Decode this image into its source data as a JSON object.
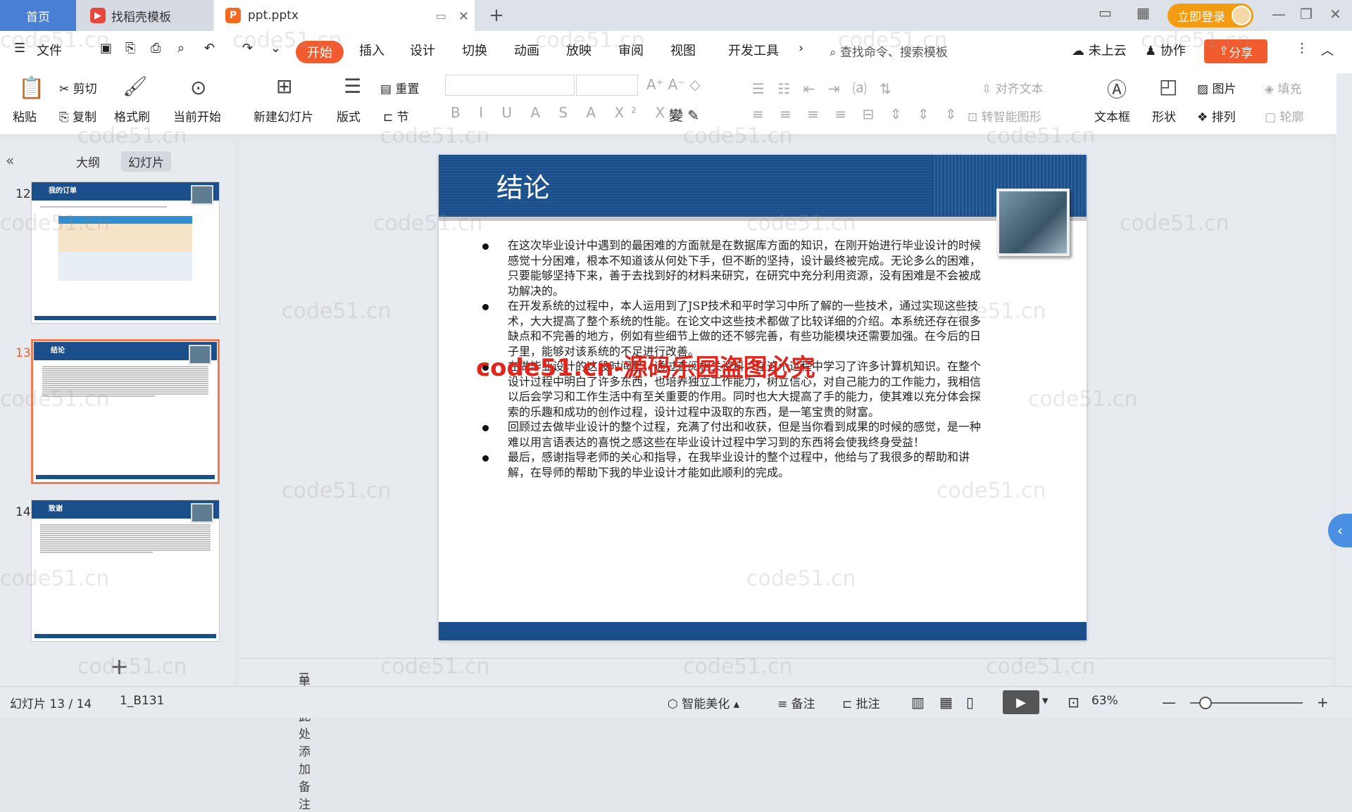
{
  "tabs": {
    "home": "首页",
    "template": "找稻壳模板",
    "document": "ppt.pptx"
  },
  "account": {
    "login": "立即登录"
  },
  "menu": {
    "file": "文件",
    "start": "开始",
    "insert": "插入",
    "design": "设计",
    "transition": "切换",
    "animation": "动画",
    "slideshow": "放映",
    "review": "审阅",
    "view": "视图",
    "devtools": "开发工具",
    "search": "查找命令、搜索模板",
    "cloud": "未上云",
    "collab": "协作",
    "share": "分享"
  },
  "ribbon": {
    "paste": "粘贴",
    "cut": "剪切",
    "copy": "复制",
    "format_painter": "格式刷",
    "from_current": "当前开始",
    "new_slide": "新建幻灯片",
    "layout": "版式",
    "reset": "重置",
    "section": "节",
    "align_text": "对齐文本",
    "smart_graphic": "转智能图形",
    "textbox": "文本框",
    "shape": "形状",
    "picture": "图片",
    "fill": "填充",
    "arrange": "排列",
    "outline": "轮廓"
  },
  "sidepanel": {
    "tab_outline": "大纲",
    "tab_slides": "幻灯片",
    "thumbs": [
      {
        "num": "12",
        "title": "我的订单"
      },
      {
        "num": "13",
        "title": "结论"
      },
      {
        "num": "14",
        "title": "致谢"
      }
    ]
  },
  "slide": {
    "title": "结论",
    "bullets": [
      "在这次毕业设计中遇到的最困难的方面就是在数据库方面的知识，在刚开始进行毕业设计的时候感觉十分困难，根本不知道该从何处下手，但不断的坚持，设计最终被完成。无论多么的困难，只要能够坚持下来，善于去找到好的材料来研究，在研究中充分利用资源，没有困难是不会被成功解决的。",
      "在开发系统的过程中，本人运用到了JSP技术和平时学习中所了解的一些技术，通过实现这些技术，大大提高了整个系统的性能。在论文中这些技术都做了比较详细的介绍。本系统还存在很多缺点和不完善的地方，例如有些细节上做的还不够完善，有些功能模块还需要加强。在今后的日子里，能够对该系统的不足进行改善。",
      "在做毕业设计的这段时间里，通过查阅相关资料，在这个过程中学习了许多计算机知识。在整个设计过程中明白了许多东西，也培养独立工作能力，树立信心，对自己能力的工作能力，我相信以后会学习和工作生活中有至关重要的作用。同时也大大提高了手的能力，使其难以充分体会探索的乐趣和成功的创作过程，设计过程中汲取的东西，是一笔宝贵的财富。",
      "回顾过去做毕业设计的整个过程，充满了付出和收获，但是当你看到成果的时候的感觉，是一种难以用言语表达的喜悦之感这些在毕业设计过程中学习到的东西将会使我终身受益！",
      "最后，感谢指导老师的关心和指导，在我毕业设计的整个过程中，他给与了我很多的帮助和讲解，在导师的帮助下我的毕业设计才能如此顺利的完成。"
    ]
  },
  "overlay": {
    "watermark_red": "code51.cn-源码乐园盗图必究",
    "watermark_grey": "code51.cn"
  },
  "notes": {
    "placeholder": "单击此处添加备注"
  },
  "status": {
    "slide_count": "幻灯片 13 / 14",
    "theme": "1_B131",
    "beautify": "智能美化",
    "notes": "备注",
    "comment": "批注",
    "zoom": "63%"
  },
  "colors": {
    "accent": "#f25b2e",
    "slide_blue": "#1b4f8b",
    "home_tab": "#4a7fd6"
  }
}
